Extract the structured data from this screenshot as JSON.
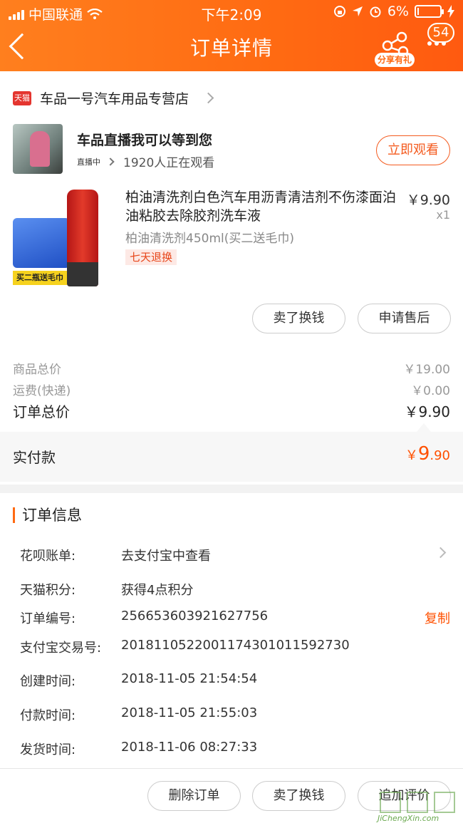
{
  "status_bar": {
    "carrier": "中国联通",
    "time": "下午2:09",
    "battery": "6%",
    "battery_level": 0.06
  },
  "nav": {
    "title": "订单详情",
    "share_label": "分享有礼",
    "badge_count": "54"
  },
  "store": {
    "badge": "天猫",
    "name": "车品一号汽车用品专营店"
  },
  "live": {
    "title": "车品直播我可以等到您",
    "tag": "直播中",
    "viewers": "1920人正在观看",
    "watch_button": "立即观看"
  },
  "product": {
    "name": "柏油清洗剂白色汽车用沥青清洁剂不伤漆面泊油粘胶去除胶剂洗车液",
    "sku": "柏油清洗剂450ml(买二送毛巾)",
    "service_tag": "七天退换",
    "price": "￥9.90",
    "qty": "x1",
    "promo_label": "买二瓶送毛巾",
    "actions": [
      "卖了换钱",
      "申请售后"
    ]
  },
  "totals": {
    "goods_label": "商品总价",
    "goods_value": "￥19.00",
    "shipping_label": "运费(快递)",
    "shipping_value": "￥0.00",
    "order_label": "订单总价",
    "order_value": "￥9.90",
    "paid_label": "实付款",
    "paid_symbol": "￥",
    "paid_int": "9",
    "paid_dec": ".90"
  },
  "order_info": {
    "title": "订单信息",
    "rows": [
      {
        "key": "花呗账单:",
        "value": "去支付宝中查看"
      },
      {
        "key": "天猫积分:",
        "value": "获得4点积分"
      },
      {
        "key": "订单编号:",
        "value": "256653603921627756",
        "action": "复制"
      },
      {
        "key": "支付宝交易号:",
        "value": "2018110522001174301011592730"
      },
      {
        "key": "创建时间:",
        "value": "2018-11-05 21:54:54"
      },
      {
        "key": "付款时间:",
        "value": "2018-11-05 21:55:03"
      },
      {
        "key": "发货时间:",
        "value": "2018-11-06 08:27:33"
      }
    ]
  },
  "bottom_bar": {
    "actions": [
      "删除订单",
      "卖了换钱",
      "追加评价"
    ]
  },
  "watermark": {
    "text": "JiChengXin.com"
  },
  "colors": {
    "accent": "#ff6a12",
    "price": "#ff5000",
    "tmall": "#e4352f"
  }
}
